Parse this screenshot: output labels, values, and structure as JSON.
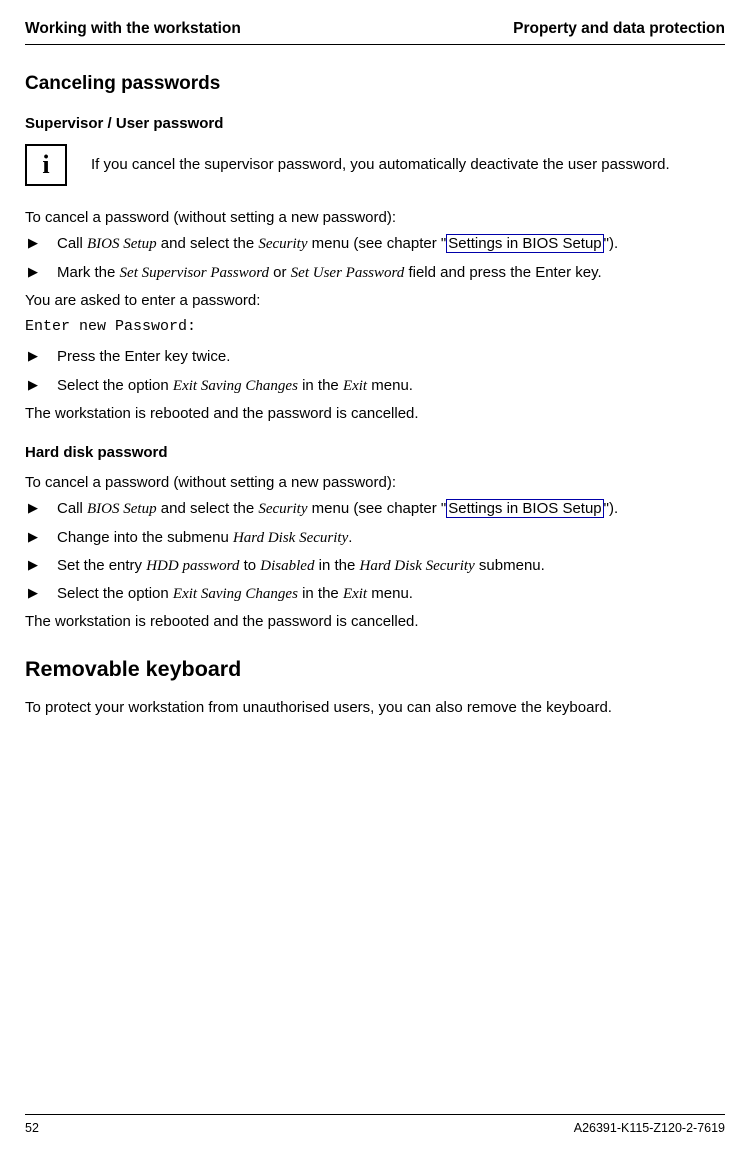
{
  "header": {
    "left": "Working with the workstation",
    "right": "Property and data protection"
  },
  "section1": {
    "title": "Canceling passwords",
    "sub1": "Supervisor / User password",
    "infoIcon": "i",
    "infoText": "If you cancel the supervisor password, you automatically deactivate the user password.",
    "intro": "To cancel a password (without setting a new password):",
    "b1_pre": "Call ",
    "b1_i1": "BIOS Setup",
    "b1_mid": " and select the ",
    "b1_i2": "Security",
    "b1_post": " menu (see chapter \"",
    "b1_link": "Settings in BIOS Setup",
    "b1_end": "\").",
    "b2_pre": "Mark the ",
    "b2_i1": "Set Supervisor Password",
    "b2_mid": " or ",
    "b2_i2": "Set User Password",
    "b2_post": " field and press the Enter key.",
    "asked": "You are asked to enter a password:",
    "mono": "Enter new Password:",
    "b3": "Press the Enter key twice.",
    "b4_pre": "Select the option ",
    "b4_i1": "Exit Saving Changes",
    "b4_mid": " in the ",
    "b4_i2": "Exit",
    "b4_post": " menu.",
    "reboot": "The workstation is rebooted and the password is cancelled."
  },
  "section2": {
    "title": "Hard disk password",
    "intro": "To cancel a password (without setting a new password):",
    "b1_pre": "Call ",
    "b1_i1": "BIOS Setup",
    "b1_mid": " and select the ",
    "b1_i2": "Security",
    "b1_post": " menu (see chapter \"",
    "b1_link": "Settings in BIOS Setup",
    "b1_end": "\").",
    "b2_pre": "Change into the submenu ",
    "b2_i1": "Hard Disk Security",
    "b2_post": ".",
    "b3_pre": "Set the entry ",
    "b3_i1": "HDD password",
    "b3_mid1": " to ",
    "b3_i2": "Disabled",
    "b3_mid2": " in the ",
    "b3_i3": "Hard Disk Security",
    "b3_post": " submenu.",
    "b4_pre": "Select the option ",
    "b4_i1": "Exit Saving Changes",
    "b4_mid": " in the ",
    "b4_i2": "Exit",
    "b4_post": " menu.",
    "reboot": "The workstation is rebooted and the password is cancelled."
  },
  "section3": {
    "title": "Removable keyboard",
    "text": "To protect your workstation from unauthorised users, you can also remove the keyboard."
  },
  "footer": {
    "page": "52",
    "docid": "A26391-K115-Z120-2-7619"
  },
  "marker": "▶"
}
